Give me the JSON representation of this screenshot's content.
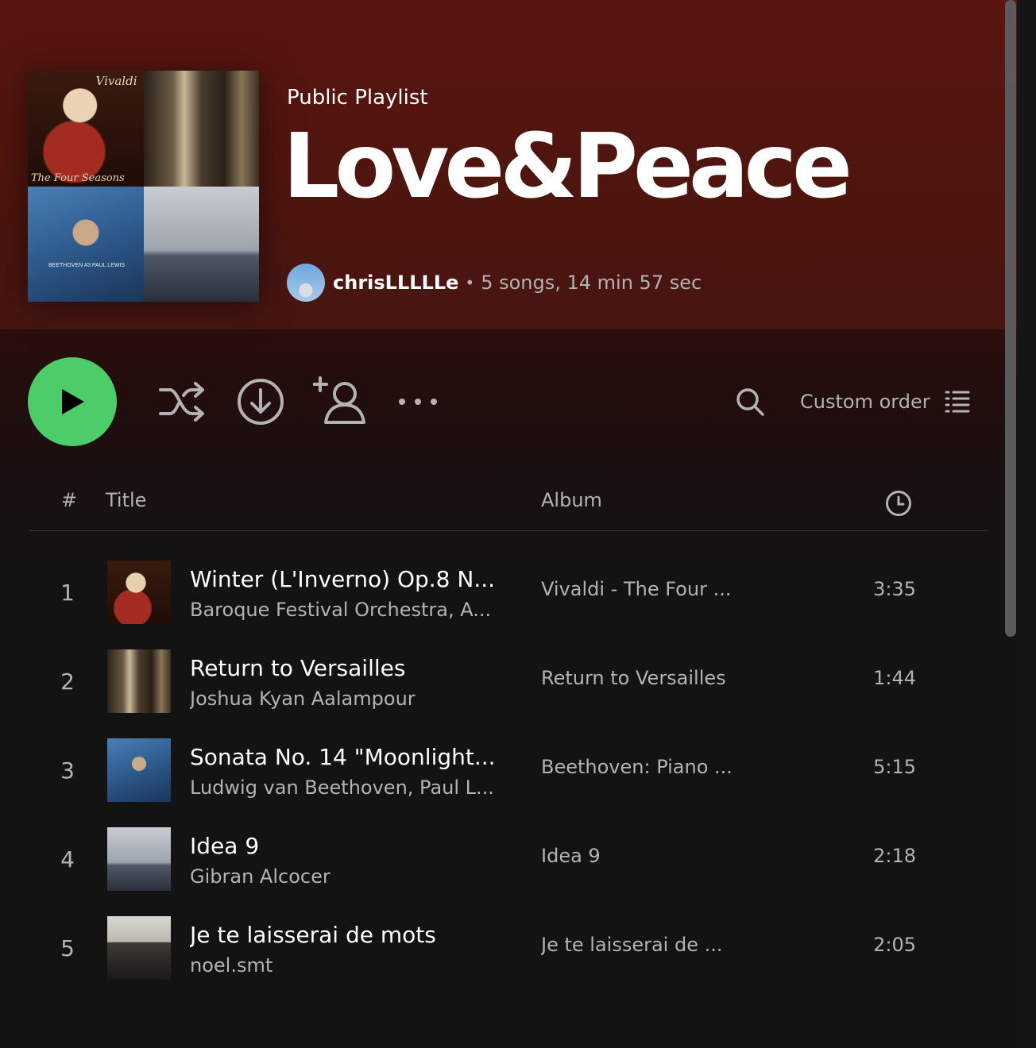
{
  "header": {
    "type_label": "Public Playlist",
    "title": "Love&Peace",
    "owner": "chrisLLLLLe",
    "separator": "•",
    "stats": "5 songs, 14 min 57 sec",
    "cover_texts": {
      "vivaldi": "Vivaldi",
      "four_seasons": "The Four Seasons",
      "beethoven": "BEETHOVEN #3 PAUL LEWIS"
    }
  },
  "actions": {
    "play_icon": "play-icon",
    "shuffle_icon": "shuffle-icon",
    "download_icon": "download-icon",
    "invite_icon": "add-user-icon",
    "more_icon": "more-icon",
    "search_icon": "search-icon",
    "sort_label": "Custom order",
    "sort_icon": "list-icon"
  },
  "table": {
    "col_number": "#",
    "col_title": "Title",
    "col_album": "Album",
    "col_duration_icon": "clock-icon",
    "rows": [
      {
        "number": "1",
        "title": "Winter (L'Inverno) Op.8 N...",
        "artist": "Baroque Festival Orchestra, A...",
        "album": "Vivaldi - The Four ...",
        "duration": "3:35"
      },
      {
        "number": "2",
        "title": "Return to Versailles",
        "artist": "Joshua Kyan Aalampour",
        "album": "Return to Versailles",
        "duration": "1:44"
      },
      {
        "number": "3",
        "title": "Sonata No. 14 \"Moonlight...",
        "artist": "Ludwig van Beethoven, Paul L...",
        "album": "Beethoven: Piano ...",
        "duration": "5:15"
      },
      {
        "number": "4",
        "title": "Idea 9",
        "artist": "Gibran Alcocer",
        "album": "Idea 9",
        "duration": "2:18"
      },
      {
        "number": "5",
        "title": "Je te laisserai de mots",
        "artist": "noel.smt",
        "album": "Je te laisserai de ...",
        "duration": "2:05"
      }
    ]
  },
  "colors": {
    "accent": "#4dcd6a",
    "header_bg": "#5a1510",
    "page_bg": "#131313",
    "muted_text": "#b3b3b3"
  }
}
